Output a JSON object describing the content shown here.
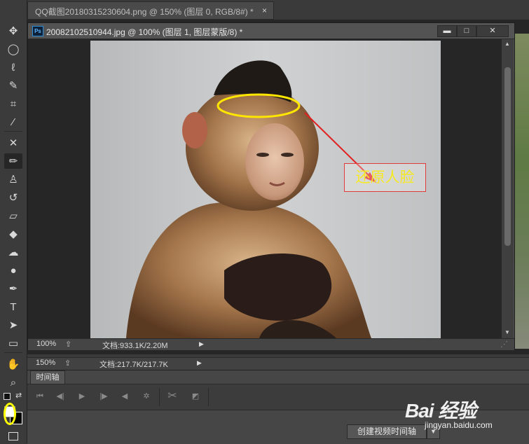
{
  "back_document": {
    "title": "QQ截图20180315230604.png @ 150% (图层 0, RGB/8#) *",
    "close": "×",
    "zoom": "150%",
    "doc_info": "文档:217.7K/217.7K"
  },
  "document": {
    "ps_badge": "Ps",
    "title": "20082102510944.jpg @ 100% (图层 1, 图层蒙版/8) *",
    "buttons": {
      "minimize": "▬",
      "maximize": "□",
      "close": "✕"
    },
    "zoom": "100%",
    "doc_info": "文档:933.1K/2.20M"
  },
  "annotation": {
    "label": "还原人脸",
    "ellipse_color": "#ffe600",
    "arrow_color": "#e02020"
  },
  "timeline": {
    "tab_label": "时间轴",
    "create_button": "创建视频时间轴",
    "dropdown": "▼"
  },
  "toolbar": {
    "tools": [
      {
        "name": "move-tool",
        "glyph": "✥"
      },
      {
        "name": "marquee-tool",
        "glyph": "◯"
      },
      {
        "name": "lasso-tool",
        "glyph": "ℓ"
      },
      {
        "name": "quick-select-tool",
        "glyph": "✎"
      },
      {
        "name": "crop-tool",
        "glyph": "⌗"
      },
      {
        "name": "eyedropper-tool",
        "glyph": "⁄"
      },
      {
        "name": "healing-tool",
        "glyph": "✕"
      },
      {
        "name": "brush-tool",
        "glyph": "✏"
      },
      {
        "name": "clone-stamp-tool",
        "glyph": "♙"
      },
      {
        "name": "history-brush-tool",
        "glyph": "↺"
      },
      {
        "name": "eraser-tool",
        "glyph": "▱"
      },
      {
        "name": "paint-bucket-tool",
        "glyph": "◆"
      },
      {
        "name": "blur-tool",
        "glyph": "☁"
      },
      {
        "name": "dodge-tool",
        "glyph": "●"
      },
      {
        "name": "pen-tool",
        "glyph": "✒"
      },
      {
        "name": "type-tool",
        "glyph": "T"
      },
      {
        "name": "path-select-tool",
        "glyph": "➤"
      },
      {
        "name": "shape-tool",
        "glyph": "▭"
      },
      {
        "name": "hand-tool",
        "glyph": "✋"
      },
      {
        "name": "zoom-tool",
        "glyph": "⌕"
      }
    ]
  },
  "watermark": {
    "logo": "Bai 经验",
    "url": "jingyan.baidu.com"
  },
  "colors": {
    "foreground": "#000000",
    "background": "#ffffff",
    "highlight": "#ffff00"
  }
}
